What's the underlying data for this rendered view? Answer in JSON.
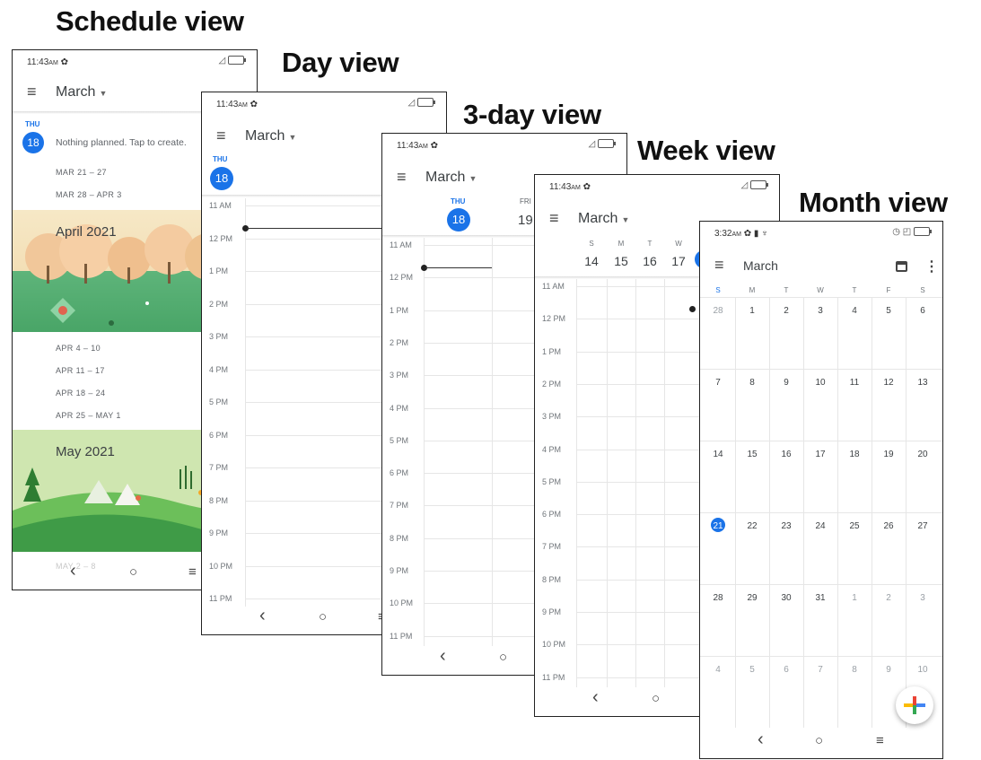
{
  "titles": {
    "schedule": "Schedule view",
    "day": "Day view",
    "three_day": "3-day view",
    "week": "Week view",
    "month": "Month view"
  },
  "status": {
    "time": "11:43",
    "ampm": "AM",
    "month_time": "3:32",
    "month_ampm": "AM"
  },
  "month_name": "March",
  "schedule": {
    "day_abbr": "THU",
    "day_num": "18",
    "nothing_planned": "Nothing planned. Tap to create.",
    "ranges_top": [
      "MAR 21 – 27",
      "MAR 28 – APR 3"
    ],
    "april_banner": "April 2021",
    "ranges_april": [
      "APR 4 – 10",
      "APR 11 – 17",
      "APR 18 – 24",
      "APR 25 – MAY 1"
    ],
    "may_banner": "May 2021",
    "partial": "MAY 2 – 8"
  },
  "day_view": {
    "day_abbr": "THU",
    "day_num": "18",
    "hours": [
      "11 AM",
      "12 PM",
      "1 PM",
      "2 PM",
      "3 PM",
      "4 PM",
      "5 PM",
      "6 PM",
      "7 PM",
      "8 PM",
      "9 PM",
      "10 PM",
      "11 PM"
    ]
  },
  "three_day": {
    "d1_abbr": "THU",
    "d1_num": "18",
    "d2_abbr": "FRI",
    "d2_num": "19",
    "hours": [
      "11 AM",
      "12 PM",
      "1 PM",
      "2 PM",
      "3 PM",
      "4 PM",
      "5 PM",
      "6 PM",
      "7 PM",
      "8 PM",
      "9 PM",
      "10 PM",
      "11 PM"
    ]
  },
  "week_view": {
    "dows": [
      "S",
      "M",
      "T",
      "W"
    ],
    "nums": [
      "14",
      "15",
      "16",
      "17"
    ],
    "hours": [
      "11 AM",
      "12 PM",
      "1 PM",
      "2 PM",
      "3 PM",
      "4 PM",
      "5 PM",
      "6 PM",
      "7 PM",
      "8 PM",
      "9 PM",
      "10 PM",
      "11 PM"
    ]
  },
  "month_view": {
    "dows": [
      "S",
      "M",
      "T",
      "W",
      "T",
      "F",
      "S"
    ],
    "weeks": [
      [
        "28",
        "1",
        "2",
        "3",
        "4",
        "5",
        "6"
      ],
      [
        "7",
        "8",
        "9",
        "10",
        "11",
        "12",
        "13"
      ],
      [
        "14",
        "15",
        "16",
        "17",
        "18",
        "19",
        "20"
      ],
      [
        "21",
        "22",
        "23",
        "24",
        "25",
        "26",
        "27"
      ],
      [
        "28",
        "29",
        "30",
        "31",
        "1",
        "2",
        "3"
      ],
      [
        "4",
        "5",
        "6",
        "7",
        "8",
        "9",
        "10"
      ]
    ],
    "today": "21"
  },
  "nav": {
    "back": "‹",
    "home": "○",
    "recents": "≡"
  },
  "colors": {
    "accent": "#1a73e8",
    "spring": "#f3e3c0",
    "meadow": "#4fae6d",
    "may_sky": "#cfe6b0"
  }
}
